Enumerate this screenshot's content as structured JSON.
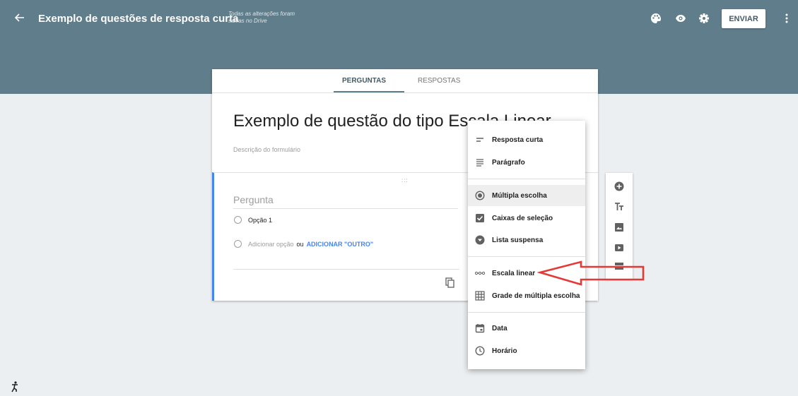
{
  "header": {
    "title": "Exemplo de questões de resposta curta",
    "save_status": "Todas as alterações foram salvas no Drive",
    "send_label": "ENVIAR",
    "bg_color": "#607d8b"
  },
  "tabs": [
    {
      "label": "PERGUNTAS",
      "active": true
    },
    {
      "label": "RESPOSTAS",
      "active": false
    }
  ],
  "form": {
    "title": "Exemplo de questão do tipo Escala Linear",
    "description_placeholder": "Descrição do formulário"
  },
  "question": {
    "title_placeholder": "Pergunta",
    "drag_handle": ":::",
    "option_1": "Opção 1",
    "add_option": "Adicionar opção",
    "or": "ou",
    "add_other": "ADICIONAR \"OUTRO\""
  },
  "type_menu": {
    "items": [
      {
        "label": "Resposta curta",
        "icon": "short-answer-icon"
      },
      {
        "label": "Parágrafo",
        "icon": "paragraph-icon"
      },
      {
        "label": "Múltipla escolha",
        "icon": "radio-icon",
        "selected": true
      },
      {
        "label": "Caixas de seleção",
        "icon": "checkbox-icon"
      },
      {
        "label": "Lista suspensa",
        "icon": "dropdown-icon"
      },
      {
        "label": "Escala linear",
        "icon": "linear-scale-icon"
      },
      {
        "label": "Grade de múltipla escolha",
        "icon": "grid-icon"
      },
      {
        "label": "Data",
        "icon": "calendar-icon"
      },
      {
        "label": "Horário",
        "icon": "clock-icon"
      }
    ]
  },
  "side_toolbar": [
    "add-question-icon",
    "title-text-icon",
    "image-icon",
    "video-icon",
    "section-icon"
  ],
  "colors": {
    "accent": "#4285f4",
    "annotation_arrow": "#e53935"
  }
}
